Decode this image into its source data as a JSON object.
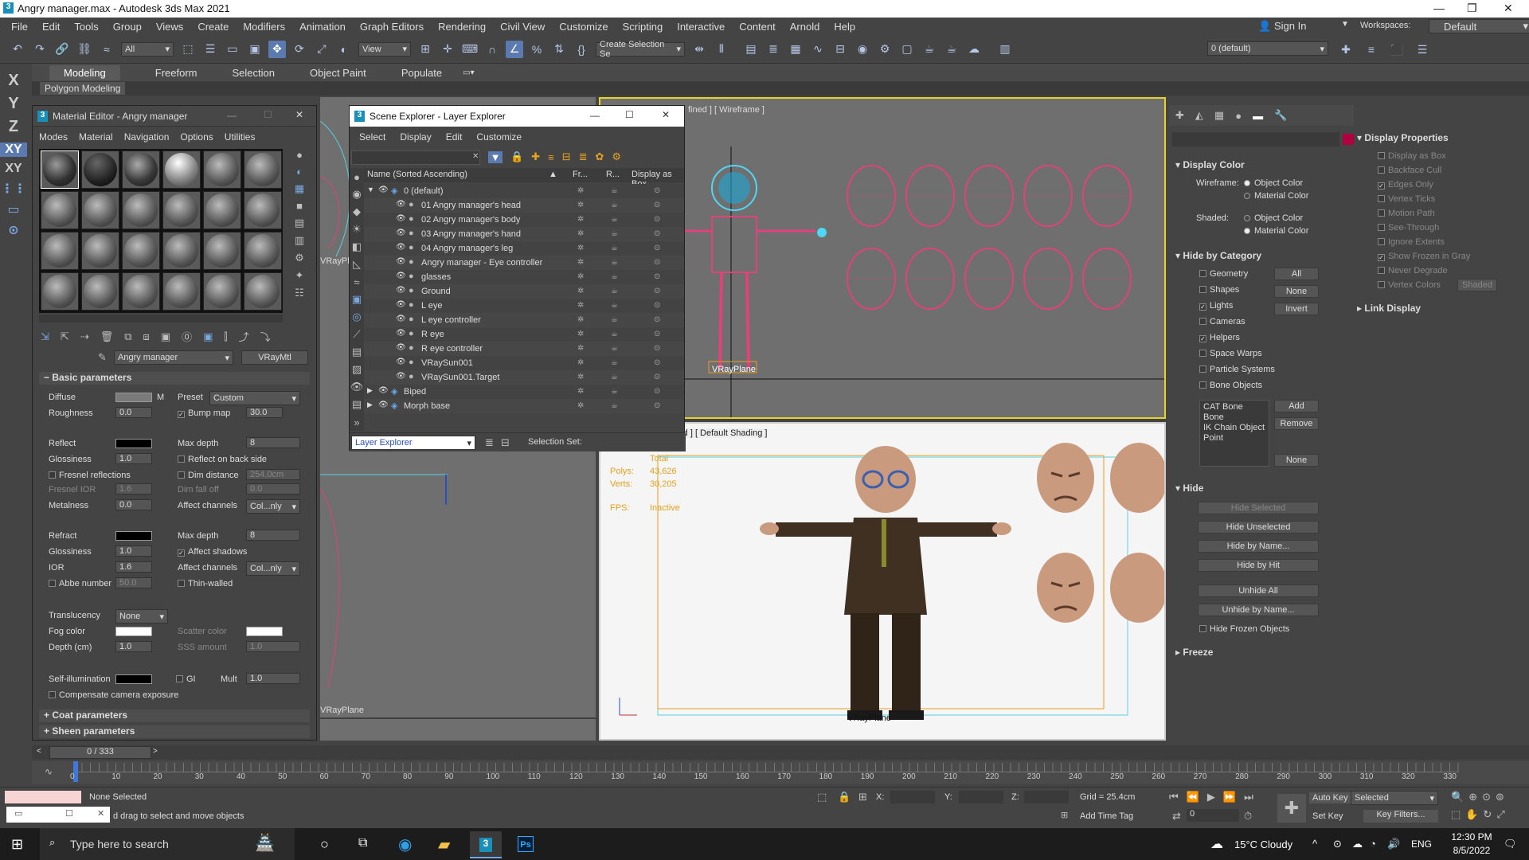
{
  "window": {
    "title": "Angry manager.max - Autodesk 3ds Max 2021"
  },
  "menu": [
    "File",
    "Edit",
    "Tools",
    "Group",
    "Views",
    "Create",
    "Modifiers",
    "Animation",
    "Graph Editors",
    "Rendering",
    "Civil View",
    "Customize",
    "Scripting",
    "Interactive",
    "Content",
    "Arnold",
    "Help"
  ],
  "account": {
    "sign_in": "Sign In",
    "workspaces_label": "Workspaces:",
    "workspace": "Default"
  },
  "toolbar": {
    "filter": "All",
    "view": "View",
    "selection_set": "Create Selection Se",
    "layer": "0 (default)"
  },
  "ribbon": {
    "tabs": [
      "Modeling",
      "Freeform",
      "Selection",
      "Object Paint",
      "Populate"
    ],
    "subtab": "Polygon Modeling"
  },
  "axes": [
    "X",
    "Y",
    "Z",
    "XY",
    "XY"
  ],
  "material_editor": {
    "title": "Material Editor - Angry manager",
    "menu": [
      "Modes",
      "Material",
      "Navigation",
      "Options",
      "Utilities"
    ],
    "material_name": "Angry manager",
    "material_type": "VRayMtl",
    "section_basic": "Basic parameters",
    "diffuse": "Diffuse",
    "preset": "Preset",
    "preset_value": "Custom",
    "roughness": "Roughness",
    "roughness_value": "0.0",
    "bump_map": "Bump map",
    "bump_value": "30.0",
    "reflect": "Reflect",
    "max_depth": "Max depth",
    "max_depth_value": "8",
    "glossiness": "Glossiness",
    "glossiness_value": "1.0",
    "reflect_back": "Reflect on back side",
    "fresnel": "Fresnel reflections",
    "dim_distance": "Dim distance",
    "dim_distance_value": "254.0cm",
    "fresnel_ior": "Fresnel IOR",
    "fresnel_ior_value": "1.6",
    "dim_falloff": "Dim fall off",
    "dim_falloff_value": "0.0",
    "metalness": "Metalness",
    "metalness_value": "0.0",
    "affect_channels": "Affect channels",
    "affect_value": "Col...nly",
    "refract": "Refract",
    "refract_max_depth_value": "8",
    "refr_glossiness_value": "1.0",
    "affect_shadows": "Affect shadows",
    "ior": "IOR",
    "ior_value": "1.6",
    "abbe": "Abbe number",
    "abbe_value": "50.0",
    "thin_walled": "Thin-walled",
    "translucency": "Translucency",
    "translucency_value": "None",
    "fog_color": "Fog color",
    "scatter_color": "Scatter color",
    "depth": "Depth (cm)",
    "depth_value": "1.0",
    "sss_amount": "SSS amount",
    "sss_value": "1.0",
    "self_illum": "Self-illumination",
    "gi": "GI",
    "mult": "Mult",
    "mult_value": "1.0",
    "compensate": "Compensate camera exposure",
    "section_coat": "Coat parameters",
    "section_sheen": "Sheen parameters"
  },
  "scene_explorer": {
    "title": "Scene Explorer - Layer Explorer",
    "menu": [
      "Select",
      "Display",
      "Edit",
      "Customize"
    ],
    "columns": [
      "Name (Sorted Ascending)",
      "Fr...",
      "R...",
      "Display as Box"
    ],
    "rows": [
      {
        "name": "0 (default)",
        "indent": 0
      },
      {
        "name": "01 Angry manager's head",
        "indent": 1
      },
      {
        "name": "02 Angry manager's body",
        "indent": 1
      },
      {
        "name": "03 Angry manager's hand",
        "indent": 1
      },
      {
        "name": "04 Angry manager's leg",
        "indent": 1
      },
      {
        "name": "Angry manager - Eye controller",
        "indent": 1
      },
      {
        "name": "glasses",
        "indent": 1
      },
      {
        "name": "Ground",
        "indent": 1
      },
      {
        "name": "L eye",
        "indent": 1
      },
      {
        "name": "L eye controller",
        "indent": 1
      },
      {
        "name": "R eye",
        "indent": 1
      },
      {
        "name": "R eye controller",
        "indent": 1
      },
      {
        "name": "VRaySun001",
        "indent": 1
      },
      {
        "name": "VRaySun001.Target",
        "indent": 1
      },
      {
        "name": "Biped",
        "indent": 0
      },
      {
        "name": "Morph base",
        "indent": 0
      }
    ],
    "explorer_mode": "Layer Explorer",
    "selection_set": "Selection Set:"
  },
  "viewports": {
    "top_right_label": "fined ] [ Wireframe ]",
    "bottom_right_label": "rd ] [ Default Shading ]",
    "vray_plane": "VRayPlane",
    "stats": {
      "total": "Total",
      "polys_label": "Polys:",
      "polys": "43,626",
      "verts_label": "Verts:",
      "verts": "30,205",
      "fps_label": "FPS:",
      "fps": "Inactive"
    }
  },
  "command_panel": {
    "display_color": "Display Color",
    "wireframe": "Wireframe:",
    "object_color": "Object Color",
    "material_color": "Material Color",
    "shaded": "Shaded:",
    "hide_by_category": "Hide by Category",
    "categories": [
      "Geometry",
      "Shapes",
      "Lights",
      "Cameras",
      "Helpers",
      "Space Warps",
      "Particle Systems",
      "Bone Objects"
    ],
    "cat_buttons": [
      "All",
      "None",
      "Invert"
    ],
    "bone_list": [
      "CAT Bone",
      "Bone",
      "IK Chain Object",
      "Point"
    ],
    "add": "Add",
    "remove": "Remove",
    "none": "None",
    "hide": "Hide",
    "hide_buttons": [
      "Hide Selected",
      "Hide Unselected",
      "Hide by Name...",
      "Hide by Hit",
      "Unhide All",
      "Unhide by Name..."
    ],
    "hide_frozen": "Hide Frozen Objects",
    "freeze": "Freeze",
    "display_properties": "Display Properties",
    "disp_items": [
      "Display as Box",
      "Backface Cull",
      "Edges Only",
      "Vertex Ticks",
      "Motion Path",
      "See-Through",
      "Ignore Extents",
      "Show Frozen in Gray",
      "Never Degrade",
      "Vertex Colors"
    ],
    "shaded_btn": "Shaded",
    "link_display": "Link Display"
  },
  "timeline": {
    "frame": "0 / 333",
    "ticks": [
      "0",
      "10",
      "20",
      "30",
      "40",
      "50",
      "60",
      "70",
      "80",
      "90",
      "100",
      "110",
      "120",
      "130",
      "140",
      "150",
      "160",
      "170",
      "180",
      "190",
      "200",
      "210",
      "220",
      "230",
      "240",
      "250",
      "260",
      "270",
      "280",
      "290",
      "300",
      "310",
      "320",
      "330"
    ]
  },
  "status": {
    "selection": "None Selected",
    "prompt": "d drag to select and move objects",
    "x": "X:",
    "y": "Y:",
    "z": "Z:",
    "grid": "Grid = 25.4cm",
    "add_time_tag": "Add Time Tag",
    "auto_key": "Auto Key",
    "selected": "Selected",
    "set_key": "Set Key",
    "key_filters": "Key Filters...",
    "frame": "0"
  },
  "taskbar": {
    "search": "Type here to search",
    "weather": "15°C  Cloudy",
    "lang": "ENG",
    "time": "12:30 PM",
    "date": "8/5/2022"
  }
}
